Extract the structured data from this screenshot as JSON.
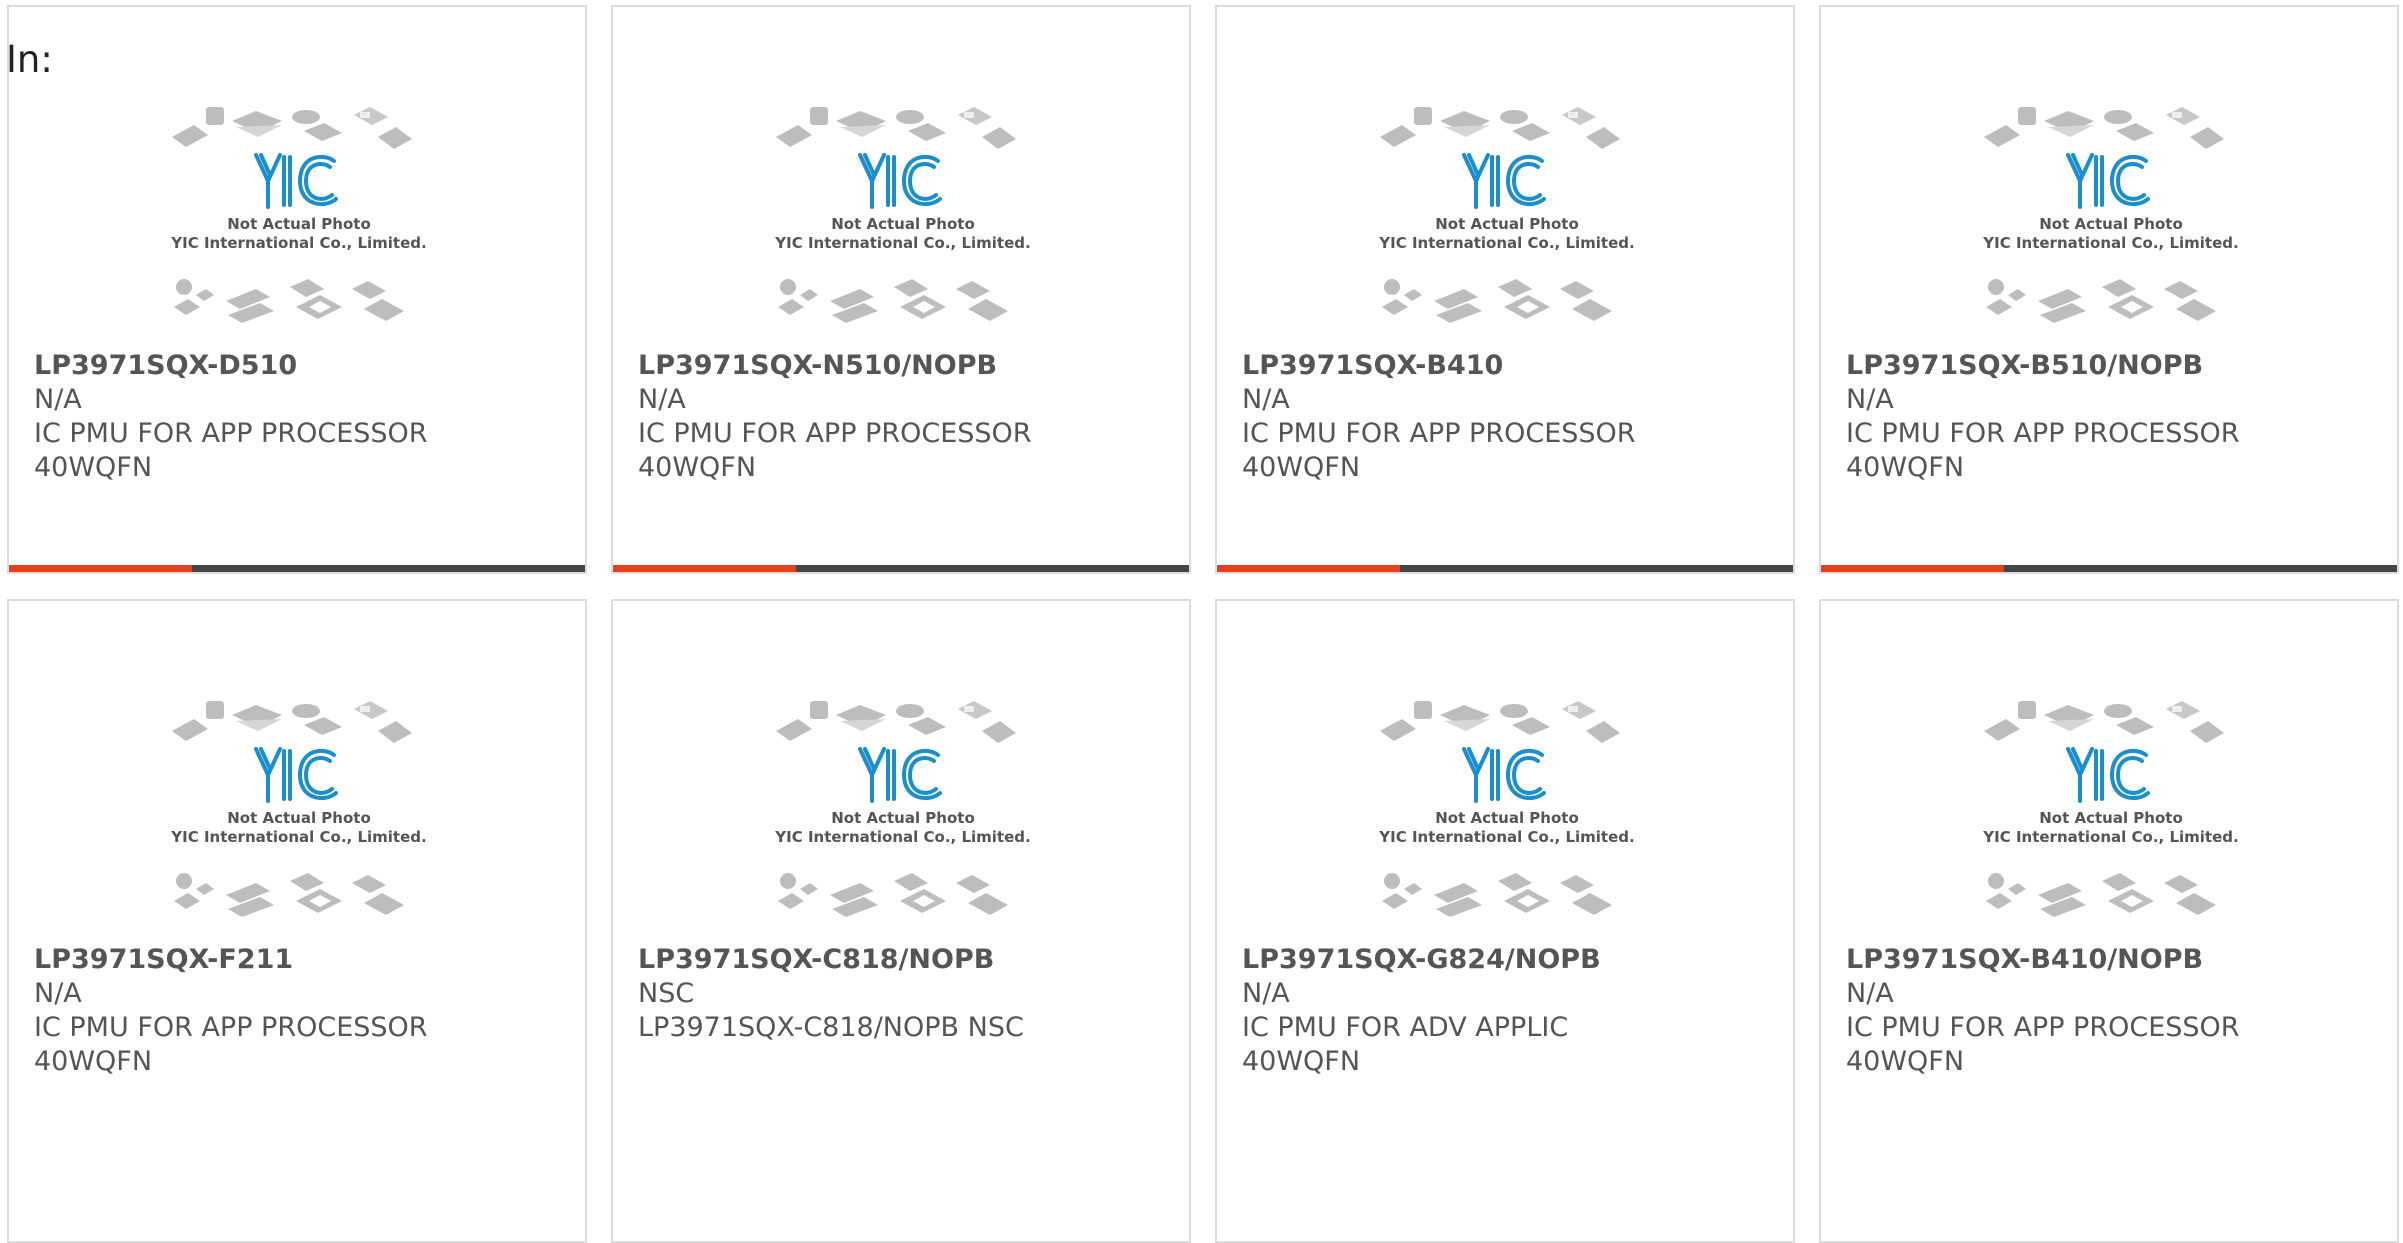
{
  "page": {
    "prefix_label": "In:"
  },
  "thumbnail": {
    "line1": "Not Actual Photo",
    "line2": "YIC International Co., Limited.",
    "brand": "YIC"
  },
  "colors": {
    "accent": "#e8401c",
    "bar": "#454545",
    "logo": "#1a8fd0",
    "border": "#dcdcdc"
  },
  "products": [
    {
      "part_number": "LP3971SQX-D510",
      "manufacturer": "N/A",
      "description": "IC PMU FOR APP PROCESSOR",
      "package": "40WQFN"
    },
    {
      "part_number": "LP3971SQX-N510/NOPB",
      "manufacturer": "N/A",
      "description": "IC PMU FOR APP PROCESSOR",
      "package": "40WQFN"
    },
    {
      "part_number": "LP3971SQX-B410",
      "manufacturer": "N/A",
      "description": "IC PMU FOR APP PROCESSOR",
      "package": "40WQFN"
    },
    {
      "part_number": "LP3971SQX-B510/NOPB",
      "manufacturer": "N/A",
      "description": "IC PMU FOR APP PROCESSOR",
      "package": "40WQFN"
    },
    {
      "part_number": "LP3971SQX-F211",
      "manufacturer": "N/A",
      "description": "IC PMU FOR APP PROCESSOR",
      "package": "40WQFN"
    },
    {
      "part_number": "LP3971SQX-C818/NOPB",
      "manufacturer": "NSC",
      "description": "LP3971SQX-C818/NOPB NSC",
      "package": ""
    },
    {
      "part_number": "LP3971SQX-G824/NOPB",
      "manufacturer": "N/A",
      "description": "IC PMU FOR ADV APPLIC",
      "package": "40WQFN"
    },
    {
      "part_number": "LP3971SQX-B410/NOPB",
      "manufacturer": "N/A",
      "description": "IC PMU FOR APP PROCESSOR",
      "package": "40WQFN"
    }
  ]
}
